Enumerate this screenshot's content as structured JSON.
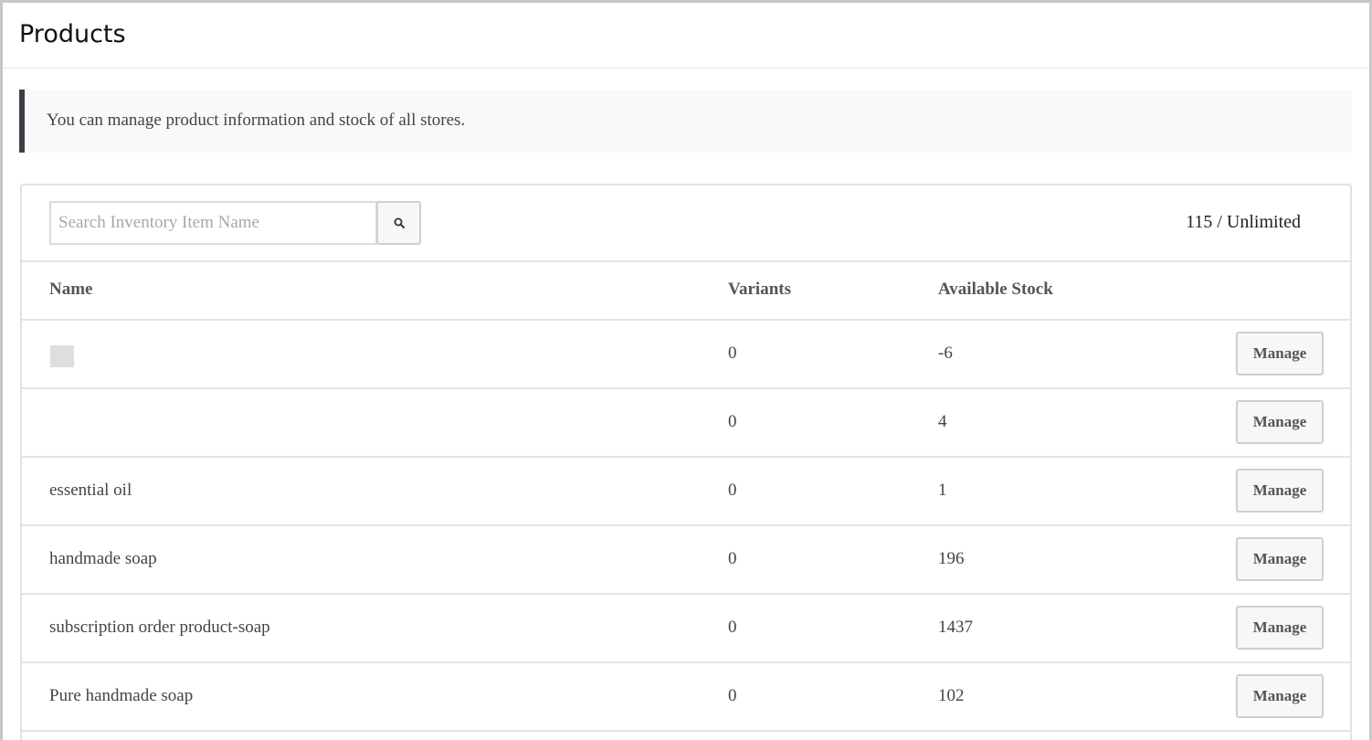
{
  "page": {
    "title": "Products",
    "info_text": "You can manage product information and stock of all stores."
  },
  "toolbar": {
    "search_placeholder": "Search Inventory Item Name",
    "search_icon": "magnifier-icon",
    "quota": "115 / Unlimited"
  },
  "table": {
    "columns": {
      "name": "Name",
      "variants": "Variants",
      "stock": "Available Stock"
    },
    "rows": [
      {
        "name": "",
        "has_thumbnail": true,
        "variants": "0",
        "stock": "-6",
        "action": "Manage"
      },
      {
        "name": "",
        "has_thumbnail": false,
        "variants": "0",
        "stock": "4",
        "action": "Manage"
      },
      {
        "name": "essential oil",
        "has_thumbnail": false,
        "variants": "0",
        "stock": "1",
        "action": "Manage"
      },
      {
        "name": "handmade soap",
        "has_thumbnail": false,
        "variants": "0",
        "stock": "196",
        "action": "Manage"
      },
      {
        "name": "subscription order product-soap",
        "has_thumbnail": false,
        "variants": "0",
        "stock": "1437",
        "action": "Manage"
      },
      {
        "name": "Pure handmade soap",
        "has_thumbnail": false,
        "variants": "0",
        "stock": "102",
        "action": "Manage"
      }
    ]
  },
  "colors": {
    "banner_accent": "#3a3f4a",
    "banner_background": "#f9f9f9",
    "border": "#e4e4e4",
    "button_background": "#f7f7f7"
  }
}
